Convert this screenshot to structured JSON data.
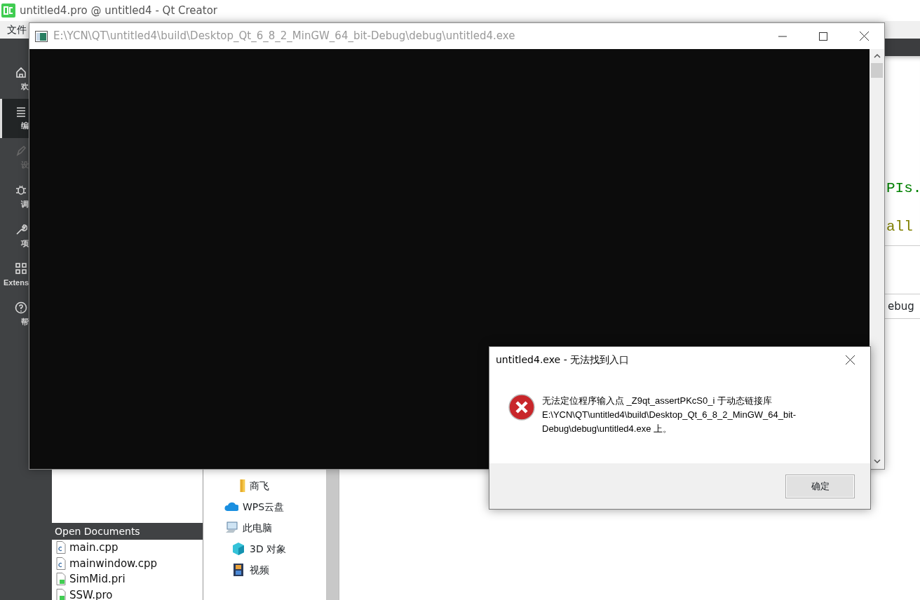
{
  "qt_creator": {
    "title": "untitled4.pro @ untitled4 - Qt Creator",
    "menu": [
      "文件"
    ],
    "modes": [
      {
        "label": "欢",
        "kind": "home",
        "selected": false,
        "disabled": false
      },
      {
        "label": "编",
        "kind": "edit",
        "selected": true,
        "disabled": false
      },
      {
        "label": "设",
        "kind": "design",
        "selected": false,
        "disabled": true
      },
      {
        "label": "调",
        "kind": "debug",
        "selected": false,
        "disabled": false
      },
      {
        "label": "项",
        "kind": "projects",
        "selected": false,
        "disabled": false
      },
      {
        "label": "Extens",
        "kind": "extensions",
        "selected": false,
        "disabled": false
      },
      {
        "label": "帮",
        "kind": "help",
        "selected": false,
        "disabled": false
      }
    ],
    "editor_lines": [
      {
        "text": "PIs.",
        "color": "#008000"
      },
      {
        "text": "all",
        "color": "#808000"
      }
    ],
    "output_row": "ebug",
    "open_documents": {
      "title": "Open Documents",
      "files": [
        {
          "name": "main.cpp",
          "kind": "cpp"
        },
        {
          "name": "mainwindow.cpp",
          "kind": "cpp"
        },
        {
          "name": "SimMid.pri",
          "kind": "qt"
        },
        {
          "name": "SSW.pro",
          "kind": "qt"
        }
      ]
    }
  },
  "file_explorer": {
    "items": [
      {
        "label": "商飞",
        "kind": "folder"
      },
      {
        "label": "WPS云盘",
        "kind": "cloud"
      },
      {
        "label": "此电脑",
        "kind": "computer"
      },
      {
        "label": "3D 对象",
        "kind": "cube"
      },
      {
        "label": "视频",
        "kind": "video"
      }
    ]
  },
  "console": {
    "title": "E:\\YCN\\QT\\untitled4\\build\\Desktop_Qt_6_8_2_MinGW_64_bit-Debug\\debug\\untitled4.exe"
  },
  "dialog": {
    "title": "untitled4.exe - 无法找到入口",
    "message": "无法定位程序输入点 _Z9qt_assertPKcS0_i 于动态链接库 E:\\YCN\\QT\\untitled4\\build\\Desktop_Qt_6_8_2_MinGW_64_bit-Debug\\debug\\untitled4.exe 上。",
    "buttons": [
      "确定"
    ]
  }
}
